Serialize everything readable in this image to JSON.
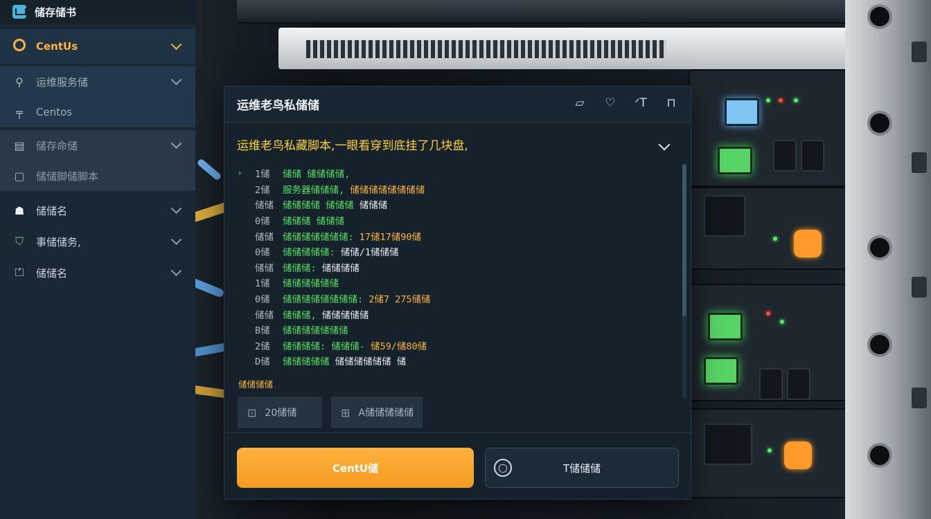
{
  "sidebar": {
    "brand": {
      "title": "储存储书",
      "icon": "app-icon"
    },
    "items": [
      {
        "label": "CentUs",
        "icon": "centos-ring-icon",
        "state": "active"
      },
      {
        "label": "运维服务储",
        "icon": "tool-icon",
        "state": "sub"
      },
      {
        "label": "Centos",
        "icon": "server-icon",
        "state": "sub"
      },
      {
        "label": "储存命储",
        "icon": "disk-icon",
        "state": "sub2"
      },
      {
        "label": "储储脚储脚本",
        "icon": "script-icon",
        "state": "sub2"
      },
      {
        "label": "储储名",
        "icon": "user-icon",
        "state": "plain"
      },
      {
        "label": "事储储务,",
        "icon": "tag-icon",
        "state": "plain"
      },
      {
        "label": "储储名",
        "icon": "laptop-icon",
        "state": "plain"
      }
    ]
  },
  "panel": {
    "title": "运维老鸟私储储",
    "tools": [
      {
        "name": "screen-icon",
        "glyph": "▱"
      },
      {
        "name": "shield-icon",
        "glyph": "♡"
      },
      {
        "name": "text-icon",
        "glyph": "ᐟT"
      },
      {
        "name": "bookmark-icon",
        "glyph": "⊓"
      }
    ],
    "subtitle": "运维老鸟私藏脚本,一眼看穿到底挂了几块盘,",
    "terminal": [
      {
        "prompt": "›",
        "num": "1储",
        "label": "储储 储储储储,",
        "value": ""
      },
      {
        "prompt": "",
        "num": "2储",
        "label": "服务器储储储, ",
        "value": "储储储储储储储储"
      },
      {
        "prompt": "",
        "num": "储储",
        "label": "储储储储 储储储 ",
        "value": "储储储",
        "vclass": "w"
      },
      {
        "prompt": "",
        "num": "0储",
        "label": "储储储 储储储",
        "value": ""
      },
      {
        "prompt": "",
        "num": "储储",
        "label": "储储储储储储储: ",
        "value": "17储17储90储"
      },
      {
        "prompt": "",
        "num": "0储",
        "label": "储储储储储: ",
        "value": "储储/1储储储",
        "vclass": "w"
      },
      {
        "prompt": "",
        "num": "储储",
        "label": "储储储: ",
        "value": "储储储储",
        "vclass": "w"
      },
      {
        "prompt": "",
        "num": "1储",
        "label": "储储储储储储",
        "value": ""
      },
      {
        "prompt": "",
        "num": "0储",
        "label": "储储储储储储储储: ",
        "value": "2储7 275储储"
      },
      {
        "prompt": "",
        "num": "储储",
        "label": "储储储, ",
        "value": "储储储储储",
        "vclass": "w"
      },
      {
        "prompt": "",
        "num": "B储",
        "label": "储储储储储储储",
        "value": ""
      },
      {
        "prompt": "",
        "num": "2储",
        "label": "储储储储: 储储储- ",
        "value": "储59/储80储"
      },
      {
        "prompt": "",
        "num": "D储",
        "label": "储储储储储 ",
        "value": "储储储储储储 储",
        "vclass": "w"
      }
    ],
    "footer_label": "储储储储",
    "chips": [
      {
        "icon": "disk-icon",
        "text": "20储储"
      },
      {
        "icon": "grid-icon",
        "text": "A储储储储储"
      }
    ],
    "primary_button": "CentU储",
    "secondary_button": "T储储储"
  },
  "colors": {
    "accent": "#ffb23e",
    "terminal_green": "#52e063",
    "terminal_orange": "#ffb23a",
    "sidebar_bg": "#1a2834",
    "panel_bg": "#15222c"
  }
}
